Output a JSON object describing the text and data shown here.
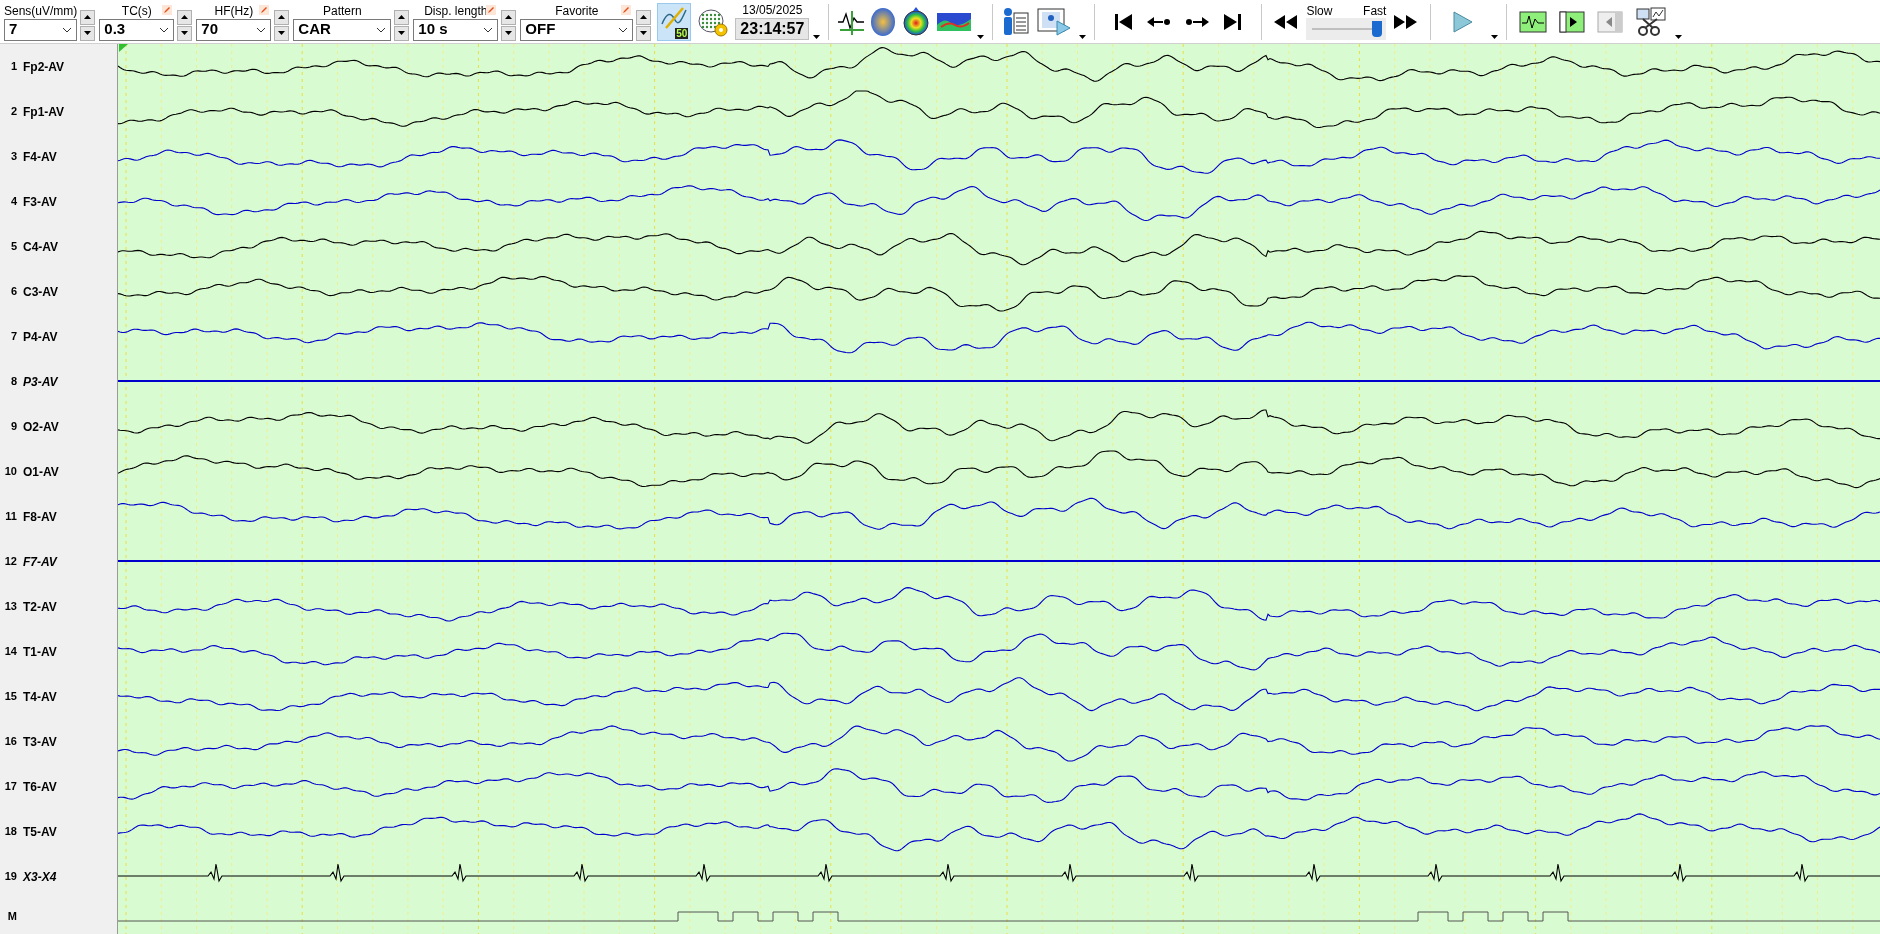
{
  "toolbar": {
    "fields": [
      {
        "label": "Sens(uV/mm)",
        "value": "7",
        "edit_icon": false
      },
      {
        "label": "TC(s)",
        "value": "0.3",
        "edit_icon": true
      },
      {
        "label": "HF(Hz)",
        "value": "70",
        "edit_icon": true
      },
      {
        "label": "Pattern",
        "value": "CAR",
        "edit_icon": false
      },
      {
        "label": "Disp. length",
        "value": "10 s",
        "edit_icon": true
      },
      {
        "label": "Favorite",
        "value": "OFF",
        "edit_icon": true
      }
    ],
    "filter_badge": "50",
    "filter_selected": true,
    "date": "13/05/2025",
    "time": "23:14:57",
    "speed": {
      "slow_label": "Slow",
      "fast_label": "Fast",
      "level": 0.88
    }
  },
  "channels": [
    {
      "number": "1",
      "name": "Fp2-AV",
      "color": "#000000",
      "disabled": false
    },
    {
      "number": "2",
      "name": "Fp1-AV",
      "color": "#000000",
      "disabled": false
    },
    {
      "number": "3",
      "name": "F4-AV",
      "color": "#0000cc",
      "disabled": false
    },
    {
      "number": "4",
      "name": "F3-AV",
      "color": "#0000cc",
      "disabled": false
    },
    {
      "number": "5",
      "name": "C4-AV",
      "color": "#000000",
      "disabled": false
    },
    {
      "number": "6",
      "name": "C3-AV",
      "color": "#000000",
      "disabled": false
    },
    {
      "number": "7",
      "name": "P4-AV",
      "color": "#0000cc",
      "disabled": false
    },
    {
      "number": "8",
      "name": "P3-AV",
      "color": "#0000cc",
      "disabled": true
    },
    {
      "number": "9",
      "name": "O2-AV",
      "color": "#000000",
      "disabled": false
    },
    {
      "number": "10",
      "name": "O1-AV",
      "color": "#000000",
      "disabled": false
    },
    {
      "number": "11",
      "name": "F8-AV",
      "color": "#0000cc",
      "disabled": false
    },
    {
      "number": "12",
      "name": "F7-AV",
      "color": "#0000cc",
      "disabled": true
    },
    {
      "number": "13",
      "name": "T2-AV",
      "color": "#0000cc",
      "disabled": false
    },
    {
      "number": "14",
      "name": "T1-AV",
      "color": "#0000cc",
      "disabled": false
    },
    {
      "number": "15",
      "name": "T4-AV",
      "color": "#0000cc",
      "disabled": false
    },
    {
      "number": "16",
      "name": "T3-AV",
      "color": "#0000cc",
      "disabled": false
    },
    {
      "number": "17",
      "name": "T6-AV",
      "color": "#0000cc",
      "disabled": false
    },
    {
      "number": "18",
      "name": "T5-AV",
      "color": "#0000cc",
      "disabled": false
    },
    {
      "number": "19",
      "name": "X3-X4",
      "color": "#000000",
      "disabled": true,
      "kind": "ecg"
    }
  ],
  "marker_row": {
    "label": "M"
  }
}
